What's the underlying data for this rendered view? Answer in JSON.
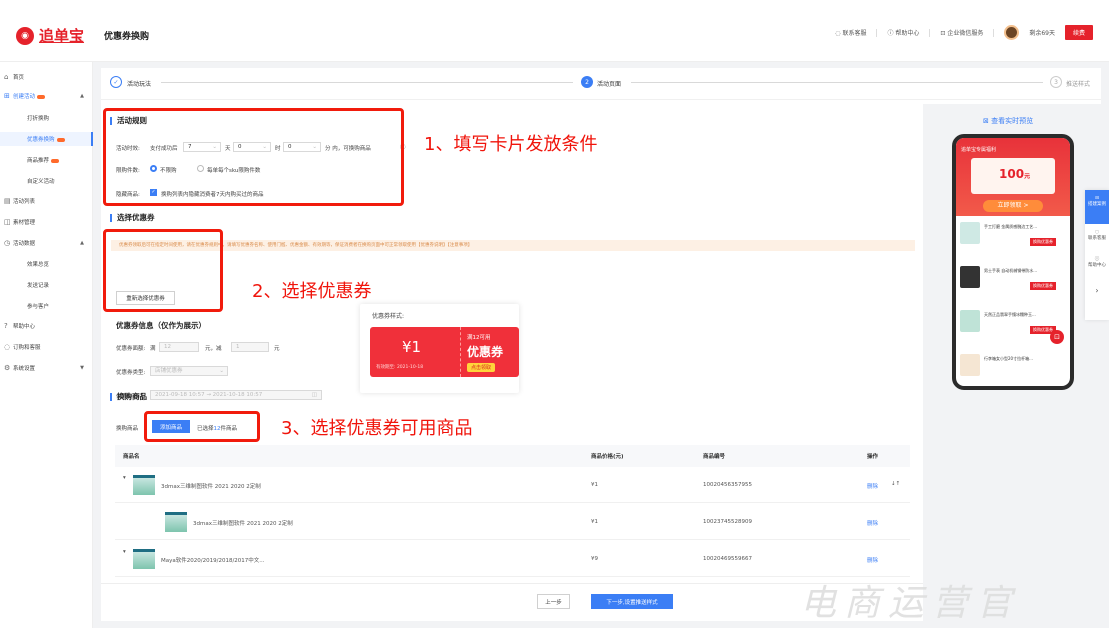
{
  "header": {
    "logo_text": "追单宝",
    "page_title": "优惠券换购",
    "links": [
      "联系客服",
      "帮助中心",
      "企业微信服务"
    ],
    "account": "剩余69天",
    "renew_label": "续费"
  },
  "sidebar": {
    "items": [
      {
        "label": "首页",
        "icon": "⌂"
      },
      {
        "label": "创建活动",
        "icon": "⊞"
      },
      {
        "label": "打折换购"
      },
      {
        "label": "优惠券换购"
      },
      {
        "label": "商品推荐"
      },
      {
        "label": "自定义活动"
      },
      {
        "label": "活动列表",
        "icon": "▤"
      },
      {
        "label": "素材管理",
        "icon": "◫"
      },
      {
        "label": "活动数据",
        "icon": "◷"
      },
      {
        "label": "效果总览"
      },
      {
        "label": "发送记录"
      },
      {
        "label": "参与客户"
      },
      {
        "label": "帮助中心",
        "icon": "?"
      },
      {
        "label": "订购和客服",
        "icon": "◌"
      },
      {
        "label": "系统设置",
        "icon": "⚙"
      }
    ]
  },
  "steps": [
    {
      "num": "✓",
      "label": "活动玩法"
    },
    {
      "num": "2",
      "label": "活动页面"
    },
    {
      "num": "3",
      "label": "推送样式"
    }
  ],
  "rules": {
    "title": "活动规则",
    "time_label": "活动时效:",
    "time_prefix": "支付成功后",
    "day_value": "7",
    "day_unit": "天",
    "hour_value": "0",
    "hour_unit": "时",
    "minute_value": "0",
    "minute_suffix": "分 内，可换购商品",
    "limit_label": "限购件数:",
    "opt_unlimited": "不限购",
    "opt_limit": "每单每个sku限购件数",
    "hide_label": "隐藏商品:",
    "hide_text": "换购列表内隐藏消费者7天内购买过的商品"
  },
  "coupon_select": {
    "title": "选择优惠券",
    "warning": "优惠券领取后可在指定时间使用，请在优惠券规则中，请填写优惠券名称、使用门槛、优惠金额、有效期等，保证消费者在换购页面中可正常领取使用【优惠券说明】【注意事项】",
    "reselect_button": "重新选择优惠券"
  },
  "coupon_info": {
    "title": "优惠券信息（仅作为展示）",
    "amount_label": "优惠券面额:",
    "full_prefix": "满",
    "full_value": "12",
    "reduce_prefix": "元，减",
    "reduce_value": "1",
    "unit": "元",
    "type_label": "优惠券类型:",
    "type_value": "店铺优惠券",
    "time_label": "优惠券时间:",
    "start": "2021-09-18 10:57",
    "arrow": "→",
    "end": "2021-10-18 10:57",
    "style_title": "优惠券样式:",
    "coupon_amount": "¥1",
    "coupon_condition": "满12可用",
    "coupon_name": "优惠券",
    "coupon_expire": "有效期至: 2021-10-18",
    "coupon_button": "点击领取"
  },
  "exchange": {
    "title": "换购商品",
    "label": "换购商品",
    "add_button": "添加商品",
    "selected_prefix": "已选择",
    "selected_count": "12",
    "selected_suffix": "件商品"
  },
  "table": {
    "headers": [
      "商品名",
      "商品价格(元)",
      "商品编号",
      "操作"
    ],
    "rows": [
      {
        "name": "3dmax三维制图软件 2021 2020 2定制",
        "price": "¥1",
        "id": "10020456357955",
        "op": "删除"
      },
      {
        "name": "3dmax三维制图软件 2021 2020 2定制",
        "price": "¥1",
        "id": "10023745528909",
        "op": "删除"
      },
      {
        "name": "Maya软件2020/2019/2018/2017中文...",
        "price": "¥9",
        "id": "10020469559667",
        "op": "删除"
      }
    ]
  },
  "annotations": [
    "1、填写卡片发放条件",
    "2、选择优惠券",
    "3、选择优惠券可用商品"
  ],
  "preview": {
    "title": "查看实时预览",
    "banner_title": "追单宝专属福利",
    "price": "100",
    "price_unit": "元",
    "claim_button": "立即领取 >",
    "items": [
      "手工打磨 金属质感腕边工艺...",
      "男士手表 自动机械钢带防水...",
      "天然正品翡翠手镯冰糯种玉...",
      "行李箱女小型20寸拉杆箱..."
    ],
    "item_button": "换购优惠券"
  },
  "float_bar": [
    "搭建案例",
    "联系客服",
    "帮助中心"
  ],
  "footer": {
    "prev_button": "上一步",
    "next_button": "下一步,设置推送样式"
  },
  "watermark": "电商运营官",
  "colors": {
    "accent": "#3b7ef5",
    "brand": "#e5222b",
    "annotation": "#f0140b"
  }
}
